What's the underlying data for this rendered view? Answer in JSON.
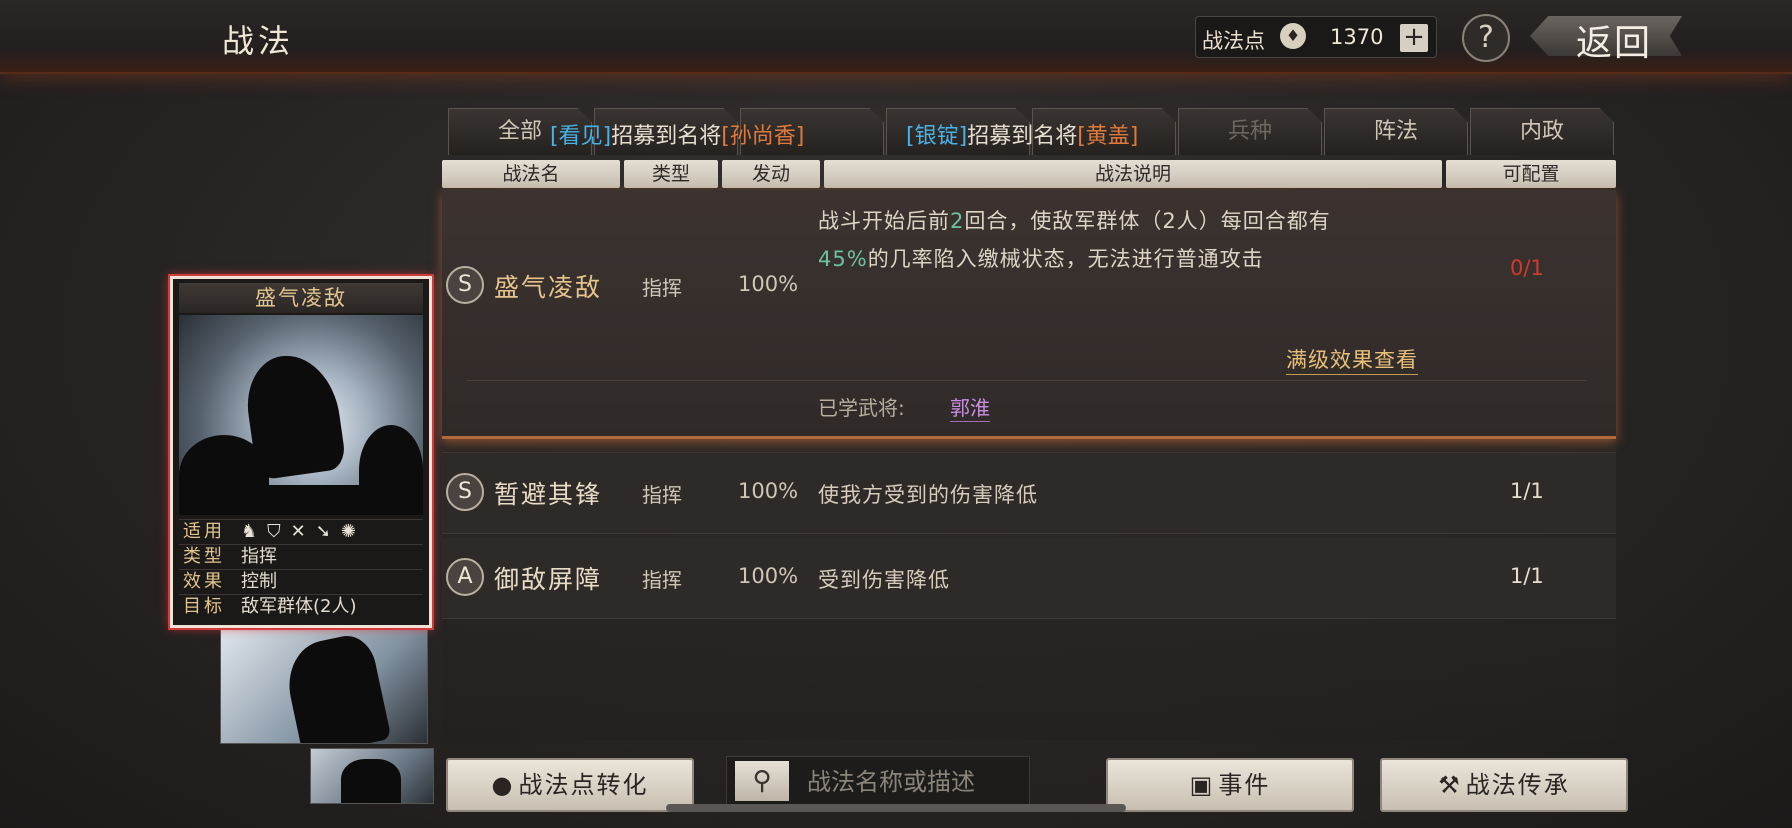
{
  "header": {
    "title": "战法",
    "points_label": "战法点",
    "points_icon": "flame-icon",
    "points_value": "1370",
    "plus_label": "+",
    "help_label": "?",
    "back_label": "返回"
  },
  "tabs": [
    "全部",
    "",
    "",
    "",
    "",
    "兵种",
    "阵法",
    "内政"
  ],
  "notices": [
    {
      "bracket_open": "[",
      "name1": "看见",
      "bracket_close": "]",
      "mid": "招募到名将",
      "name2": "[孙尚香]"
    },
    {
      "bracket_open": "[",
      "name1": "银锭",
      "bracket_close": "]",
      "mid": "招募到名将",
      "name2": "[黄盖]"
    }
  ],
  "columns": [
    "战法名",
    "类型",
    "发动",
    "战法说明",
    "可配置"
  ],
  "skills": [
    {
      "grade": "S",
      "name": "盛气凌敌",
      "type": "指挥",
      "rate": "100%",
      "desc_part1": "战斗开始后前",
      "desc_num1": "2",
      "desc_part2": "回合，使敌军群体（2人）每回合都有",
      "desc_num2": "45%",
      "desc_part3": "的几率陷入缴械状态，无法进行普通攻击",
      "config": "0/1",
      "max_level_link": "满级效果查看",
      "learned_label": "已学武将:",
      "learned_general": "郭淮"
    },
    {
      "grade": "S",
      "name": "暂避其锋",
      "type": "指挥",
      "rate": "100%",
      "desc": "使我方受到的伤害降低",
      "config": "1/1"
    },
    {
      "grade": "A",
      "name": "御敌屏障",
      "type": "指挥",
      "rate": "100%",
      "desc": "受到伤害降低",
      "config": "1/1"
    }
  ],
  "card": {
    "title": "盛气凌敌",
    "applies_label": "适用",
    "applies_icons": [
      "cavalry-icon",
      "shield-icon",
      "bow-icon",
      "spear-icon",
      "siege-icon"
    ],
    "type_label": "类型",
    "type_value": "指挥",
    "effect_label": "效果",
    "effect_value": "控制",
    "target_label": "目标",
    "target_value": "敌军群体(2人)"
  },
  "bottom": {
    "convert_label": "战法点转化",
    "search_placeholder": "战法名称或描述",
    "events_label": "事件",
    "inherit_label": "战法传承"
  },
  "colors": {
    "accent_gold": "#e6c48c",
    "highlight_green": "#6ec1a0",
    "notice_blue": "#47b2e8",
    "notice_orange": "#e07a3c",
    "config_red": "#d23a2a",
    "general_purple": "#c98fe0"
  }
}
